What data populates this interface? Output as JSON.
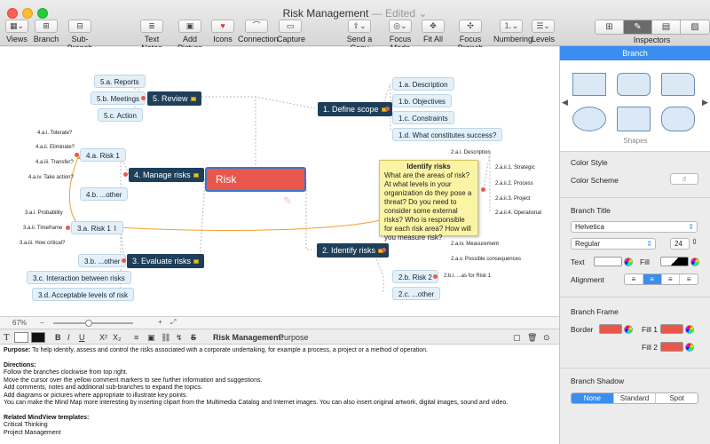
{
  "window": {
    "title": "Risk Management",
    "edited": "— Edited ⌄"
  },
  "toolbar": {
    "views": "Views",
    "branch": "Branch",
    "sub_branch": "Sub-Branch",
    "text_notes": "Text Notes",
    "add_picture": "Add Picture",
    "icons": "Icons",
    "connection": "Connection",
    "capture": "Capture",
    "send_copy": "Send a Copy",
    "focus_mode": "Focus Mode",
    "fit_all": "Fit All",
    "focus_branch": "Focus Branch",
    "numbering": "Numbering",
    "levels": "Levels",
    "inspectors": "Inspectors"
  },
  "map": {
    "root": "Risk Management",
    "review": {
      "label": "5.   Review",
      "children": [
        "5.a.  Reports",
        "5.b.  Meetings",
        "5.c.  Action"
      ]
    },
    "manage": {
      "label": "4.   Manage risks",
      "risk1": "4.a.  Risk 1",
      "other": "4.b.  ...other",
      "leaves": [
        "4.a.i.  Tolerate?",
        "4.a.ii.  Eliminate?",
        "4.a.iii.  Transfer?",
        "4.a.iv.  Take action?"
      ]
    },
    "evaluate": {
      "label": "3.   Evaluate risks",
      "risk1": "3.a.  Risk 1",
      "other": "3.b.  ...other",
      "c": "3.c.  Interaction between risks",
      "d": "3.d.  Acceptable levels of risk",
      "leaves": [
        "3.a.i.  Probability",
        "3.a.ii.  Timeframe",
        "3.a.iii.  How critical?"
      ]
    },
    "define": {
      "label": "1.   Define scope",
      "children": [
        "1.a.  Description",
        "1.b.  Objectives",
        "1.c.  Constraints",
        "1.d.  What constitutes success?"
      ]
    },
    "identify": {
      "label": "2.   Identify risks",
      "risk2": "2.b.  Risk 2",
      "other": "2.c.  ...other",
      "leaves": [
        "2.a.i.  Description",
        "2.a.ii.1.  Strategic",
        "2.a.ii.2.  Process",
        "2.a.ii.3.  Project",
        "2.a.ii.4.  Operational",
        "2.a.iv.  Measurement",
        "2.a.v.  Possible consequences",
        "2.b.i.  ...as for Risk 1"
      ]
    }
  },
  "tooltip": {
    "title": "Identify risks",
    "body": "What are the areas of risk? At what levels in your organization do they pose a threat? Do you need to consider some external risks? Who is responsible for each risk area? How will you measure risk?"
  },
  "status": {
    "zoom": "67%"
  },
  "format": {
    "bold": "B",
    "italic": "I",
    "underline": "U",
    "superscript": "X²",
    "subscript": "X₂",
    "breadcrumb_topic": "Risk Management:",
    "breadcrumb_sub": "Purpose"
  },
  "notes": {
    "purpose_label": "Purpose:",
    "purpose": " To help identify, assess and control the risks associated with a corporate undertaking, for example a process, a project or a method of operation.",
    "directions_label": "Directions:",
    "directions": [
      "Follow the branches clockwise from top right.",
      "Move the cursor over the yellow comment markers to see further information and suggestions.",
      "Add comments, notes and additional sub-branches to expand the topics.",
      "Add diagrams or pictures where appropriate to illustrate key points.",
      "You can make the Mind Map more interesting by inserting clipart from the Multimedia Catalog and Internet images. You can also insert original artwork, digital images, sound and video."
    ],
    "templates_label": "Related MindView templates:",
    "templates": [
      "Critical Thinking",
      "Project Management"
    ]
  },
  "inspector": {
    "header": "Branch",
    "shapes_label": "Shapes",
    "color_style": "Color Style",
    "color_scheme": "Color Scheme",
    "branch_title": "Branch Title",
    "font": "Helvetica",
    "weight": "Regular",
    "size": "24",
    "text_label": "Text",
    "fill_label": "Fill",
    "alignment": "Alignment",
    "branch_frame": "Branch Frame",
    "border": "Border",
    "fill1": "Fill 1",
    "fill2": "Fill 2",
    "branch_shadow": "Branch Shadow",
    "shadow_options": [
      "None",
      "Standard",
      "Spot"
    ],
    "colors": {
      "accent": "#3a8ef0",
      "frame_red": "#e9574c",
      "branch_navy": "#1e3f5a"
    }
  }
}
